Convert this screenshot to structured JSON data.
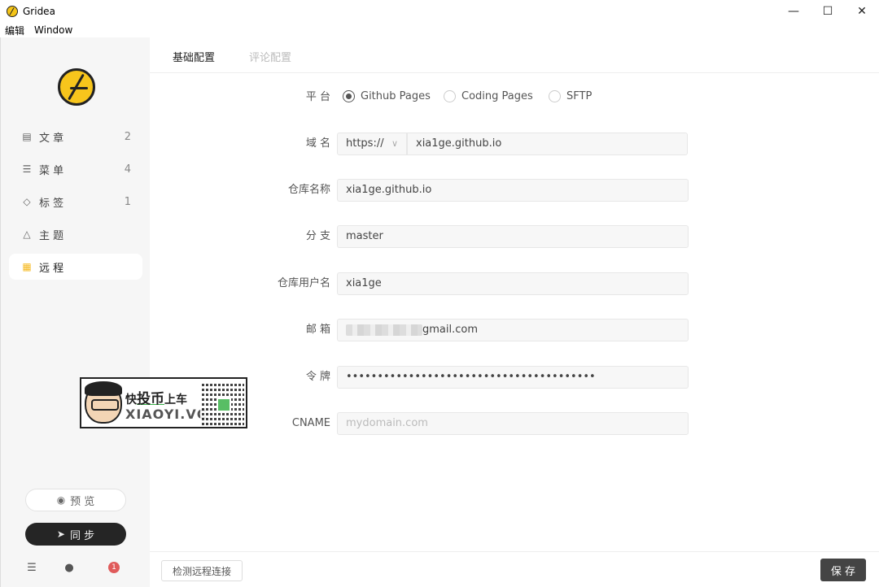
{
  "window": {
    "title": "Gridea"
  },
  "menu": [
    "编辑",
    "Window"
  ],
  "sidebar": {
    "items": [
      {
        "label": "文 章",
        "count": "2",
        "icon": "article-icon"
      },
      {
        "label": "菜 单",
        "count": "4",
        "icon": "menu-icon"
      },
      {
        "label": "标 签",
        "count": "1",
        "icon": "tag-icon"
      },
      {
        "label": "主 题",
        "count": "",
        "icon": "theme-icon"
      },
      {
        "label": "远 程",
        "count": "",
        "icon": "remote-icon",
        "active": true
      }
    ],
    "preview_label": "预 览",
    "sync_label": "同 步",
    "notification_count": "1"
  },
  "tabs": [
    {
      "label": "基础配置",
      "active": true
    },
    {
      "label": "评论配置",
      "active": false
    }
  ],
  "form": {
    "platform": {
      "label": "平 台",
      "options": [
        "Github Pages",
        "Coding Pages",
        "SFTP"
      ],
      "selected": "Github Pages"
    },
    "domain": {
      "label": "域 名",
      "protocol": "https://",
      "value": "xia1ge.github.io"
    },
    "repo_name": {
      "label": "仓库名称",
      "value": "xia1ge.github.io"
    },
    "branch": {
      "label": "分 支",
      "value": "master"
    },
    "repo_user": {
      "label": "仓库用户名",
      "value": "xia1ge"
    },
    "email": {
      "label": "邮 箱",
      "value_suffix": "gmail.com"
    },
    "token": {
      "label": "令 牌",
      "value": "••••••••••••••••••••••••••••••••••••••••"
    },
    "cname": {
      "label": "CNAME",
      "placeholder": "mydomain.com"
    }
  },
  "watermark": {
    "line1_a": "快",
    "line1_b": "投币",
    "line1_c": "上车",
    "line2": "XIAOYI.VC"
  },
  "footer": {
    "check_label": "检测远程连接",
    "save_label": "保 存"
  },
  "colors": {
    "accent": "#f5b81c",
    "dark": "#252525"
  }
}
